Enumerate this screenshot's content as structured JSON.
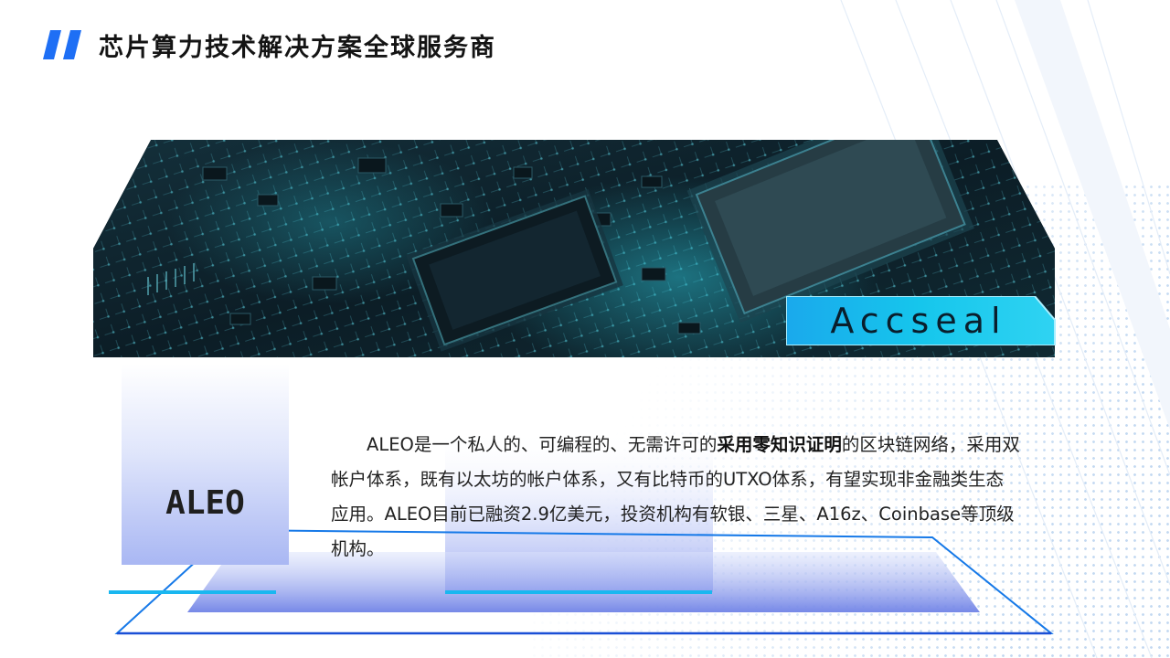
{
  "header": {
    "title": "芯片算力技术解决方案全球服务商"
  },
  "banner": {
    "brand": "Accseal",
    "image_subject": "circuit board with processor chips"
  },
  "project": {
    "name": "ALEO",
    "description_before": "ALEO是一个私人的、可编程的、无需许可的",
    "description_emphasis": "采用零知识证明",
    "description_after": "的区块链网络，采用双帐户体系，既有以太坊的帐户体系，又有比特币的UTXO体系，有望实现非金融类生态应用。ALEO目前已融资2.9亿美元，投资机构有软银、三星、A16z、Coinbase等顶级机构。"
  },
  "colors": {
    "accent_blue": "#1e6ff5",
    "cyan": "#19b7f0",
    "tag_cyan": "#16c6ec",
    "tile_purple": "#a9b7f3",
    "banner_dark": "#0b1a22"
  }
}
